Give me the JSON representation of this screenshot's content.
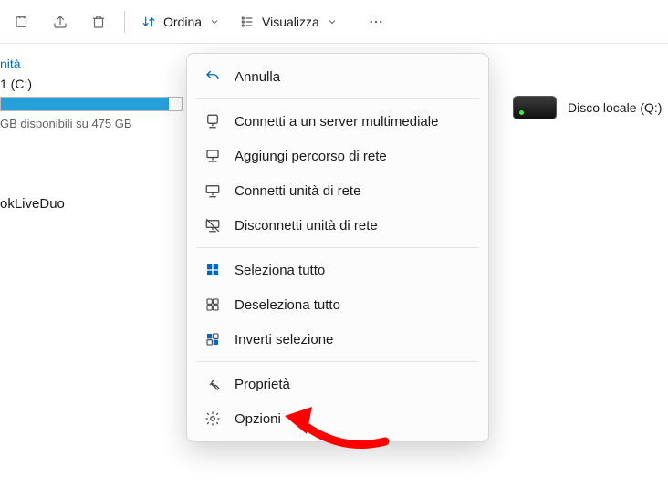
{
  "toolbar": {
    "sort_label": "Ordina",
    "view_label": "Visualizza"
  },
  "drives": {
    "group_label": "nità",
    "c": {
      "label": "1 (C:)",
      "sub": "GB disponibili su 475 GB",
      "fill_pct": 93
    },
    "q": {
      "label": "Disco locale (Q:)"
    }
  },
  "network_location_label": "okLiveDuo",
  "menu": {
    "undo": "Annulla",
    "connect_media": "Connetti a un server multimediale",
    "add_net_path": "Aggiungi percorso di rete",
    "map_drive": "Connetti unità di rete",
    "disconnect_drive": "Disconnetti unità di rete",
    "select_all": "Seleziona tutto",
    "deselect_all": "Deseleziona tutto",
    "invert_sel": "Inverti selezione",
    "properties": "Proprietà",
    "options": "Opzioni"
  }
}
